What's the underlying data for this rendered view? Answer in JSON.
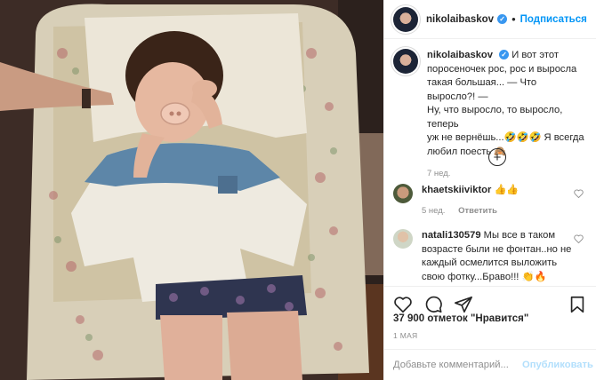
{
  "post": {
    "username": "nikolaibaskov",
    "follow_label": "Подписаться",
    "dot": "•",
    "verified_mark": "✓",
    "caption_line1": "И вот этот",
    "caption_line2": "поросеночек рос, рос и выросла",
    "caption_line3": "такая большая... — Что выросло?! —",
    "caption_line4": "Ну, что выросло, то выросло, теперь",
    "caption_line5": "уж не вернёшь...🤣🤣🤣 Я всегда",
    "caption_line6": "любил поесть 🙈",
    "caption_time": "7 нед.",
    "load_more": "+",
    "likes": "37 900 отметок \"Нравится\"",
    "date": "1 МАЯ",
    "comment_placeholder": "Добавьте комментарий...",
    "publish_label": "Опубликовать"
  },
  "comments": [
    {
      "username": "khaetskiiviktor",
      "text": "👍👍",
      "time": "5 нед.",
      "reply": "Ответить"
    },
    {
      "username": "natali130579",
      "text_line1": "Мы все в таком",
      "text_line2": "возрасте были не фонтан..но не",
      "text_line3": "каждый осмелится выложить",
      "text_line4": "свою фотку...Браво!!! 👏🔥"
    }
  ],
  "icons": [
    "heart-icon",
    "comment-icon",
    "share-icon",
    "bookmark-icon",
    "add-circle-icon",
    "verified-icon"
  ],
  "colors": {
    "link": "#0095f6",
    "verified": "#3897f0",
    "muted": "#8e8e8e",
    "text": "#262626",
    "post_disabled": "#b2dffc"
  }
}
